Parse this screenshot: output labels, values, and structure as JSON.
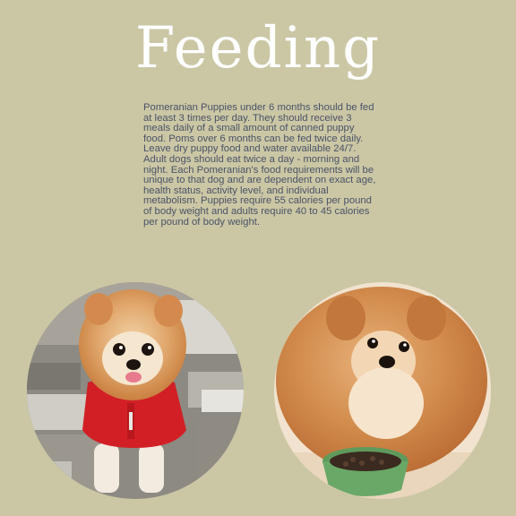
{
  "page": {
    "title": "Feeding",
    "body_text": "Pomeranian Puppies under 6 months should be fed at least 3 times per day. They should receive 3 meals daily of a small amount of canned puppy food. Poms over 6 months can be fed twice daily. Leave dry puppy food and water available 24/7. Adult dogs should eat twice a day - morning and night. Each Pomeranian's food requirements will be unique to that dog and are dependent on exact age, health status, activity level, and individual metabolism. Puppies require 55 calories per pound of body weight and adults require 40 to 45 calories per pound of body weight."
  },
  "colors": {
    "background": "#cbc7a5",
    "title": "#ffffff",
    "body_text": "#4b5266"
  }
}
